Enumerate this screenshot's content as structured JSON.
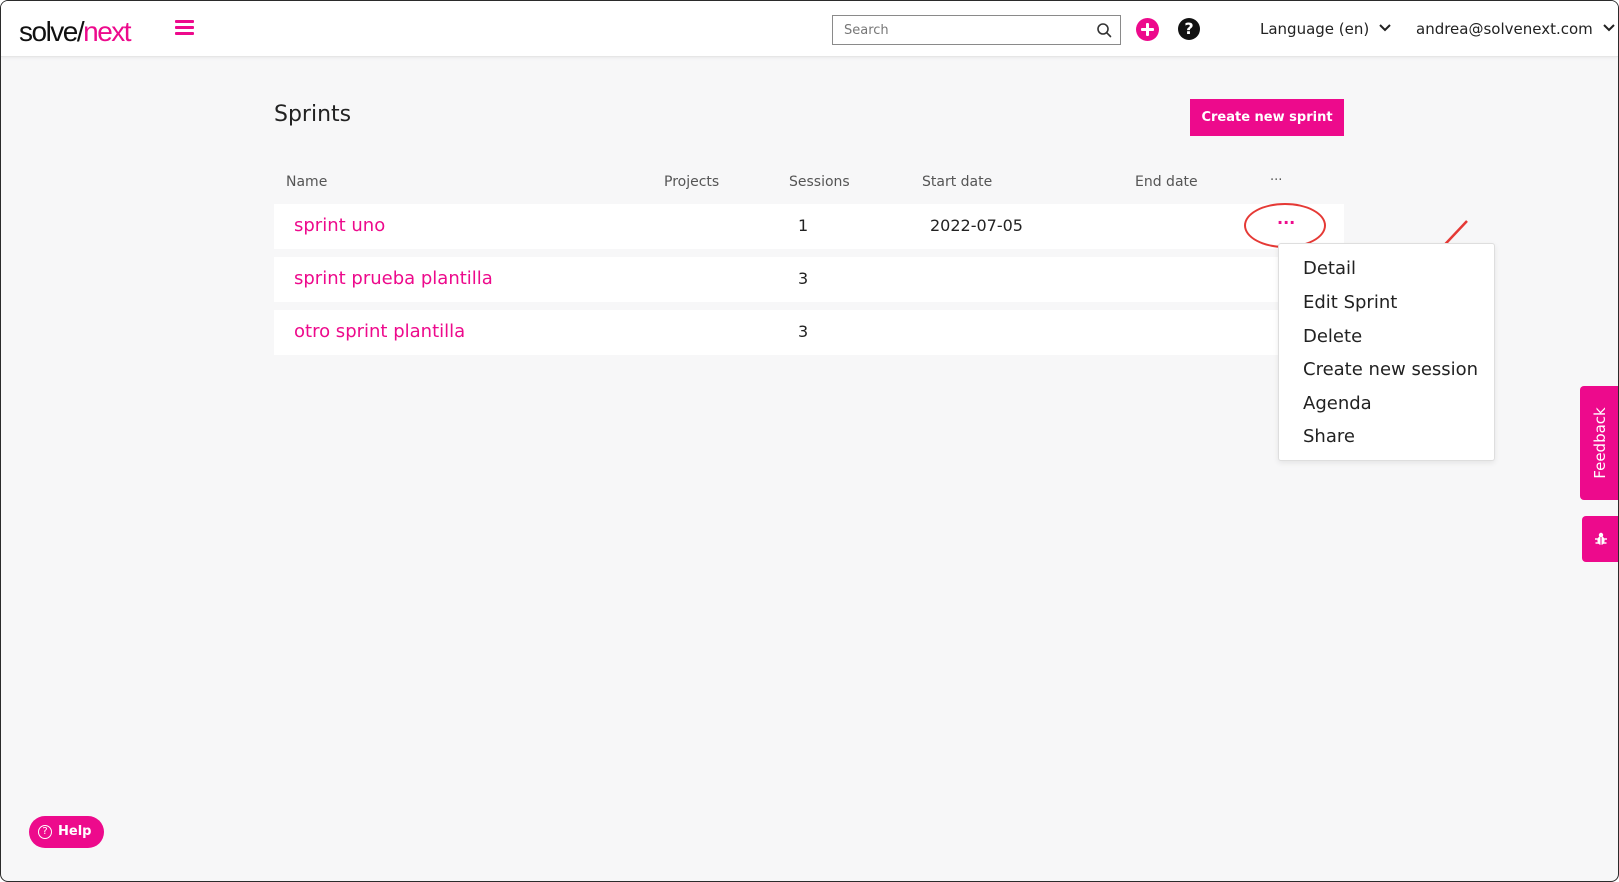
{
  "header": {
    "logo": {
      "part1": "solve",
      "slash": "/",
      "part2": "next"
    },
    "search_placeholder": "Search",
    "help_glyph": "?",
    "language_label": "Language (en)",
    "user_email": "andrea@solvenext.com"
  },
  "page": {
    "title": "Sprints",
    "create_button": "Create new sprint"
  },
  "table": {
    "columns": [
      "Name",
      "Projects",
      "Sessions",
      "Start date",
      "End date",
      "···"
    ],
    "rows": [
      {
        "name": "sprint uno",
        "projects": "",
        "sessions": "1",
        "start_date": "2022-07-05",
        "end_date": ""
      },
      {
        "name": "sprint prueba plantilla",
        "projects": "",
        "sessions": "3",
        "start_date": "",
        "end_date": ""
      },
      {
        "name": "otro sprint plantilla",
        "projects": "",
        "sessions": "3",
        "start_date": "",
        "end_date": ""
      }
    ],
    "row_menu_glyph": "···"
  },
  "menu": {
    "items": [
      "Detail",
      "Edit Sprint",
      "Delete",
      "Create new session",
      "Agenda",
      "Share"
    ]
  },
  "side": {
    "feedback_label": "Feedback",
    "help_label": "Help",
    "help_glyph": "?"
  },
  "colors": {
    "accent": "#ed0a8c",
    "annotation": "#e53935"
  },
  "icons": [
    "hamburger-icon",
    "search-icon",
    "plus-icon",
    "question-icon",
    "chevron-down-icon",
    "bug-icon",
    "help-circle-icon"
  ]
}
